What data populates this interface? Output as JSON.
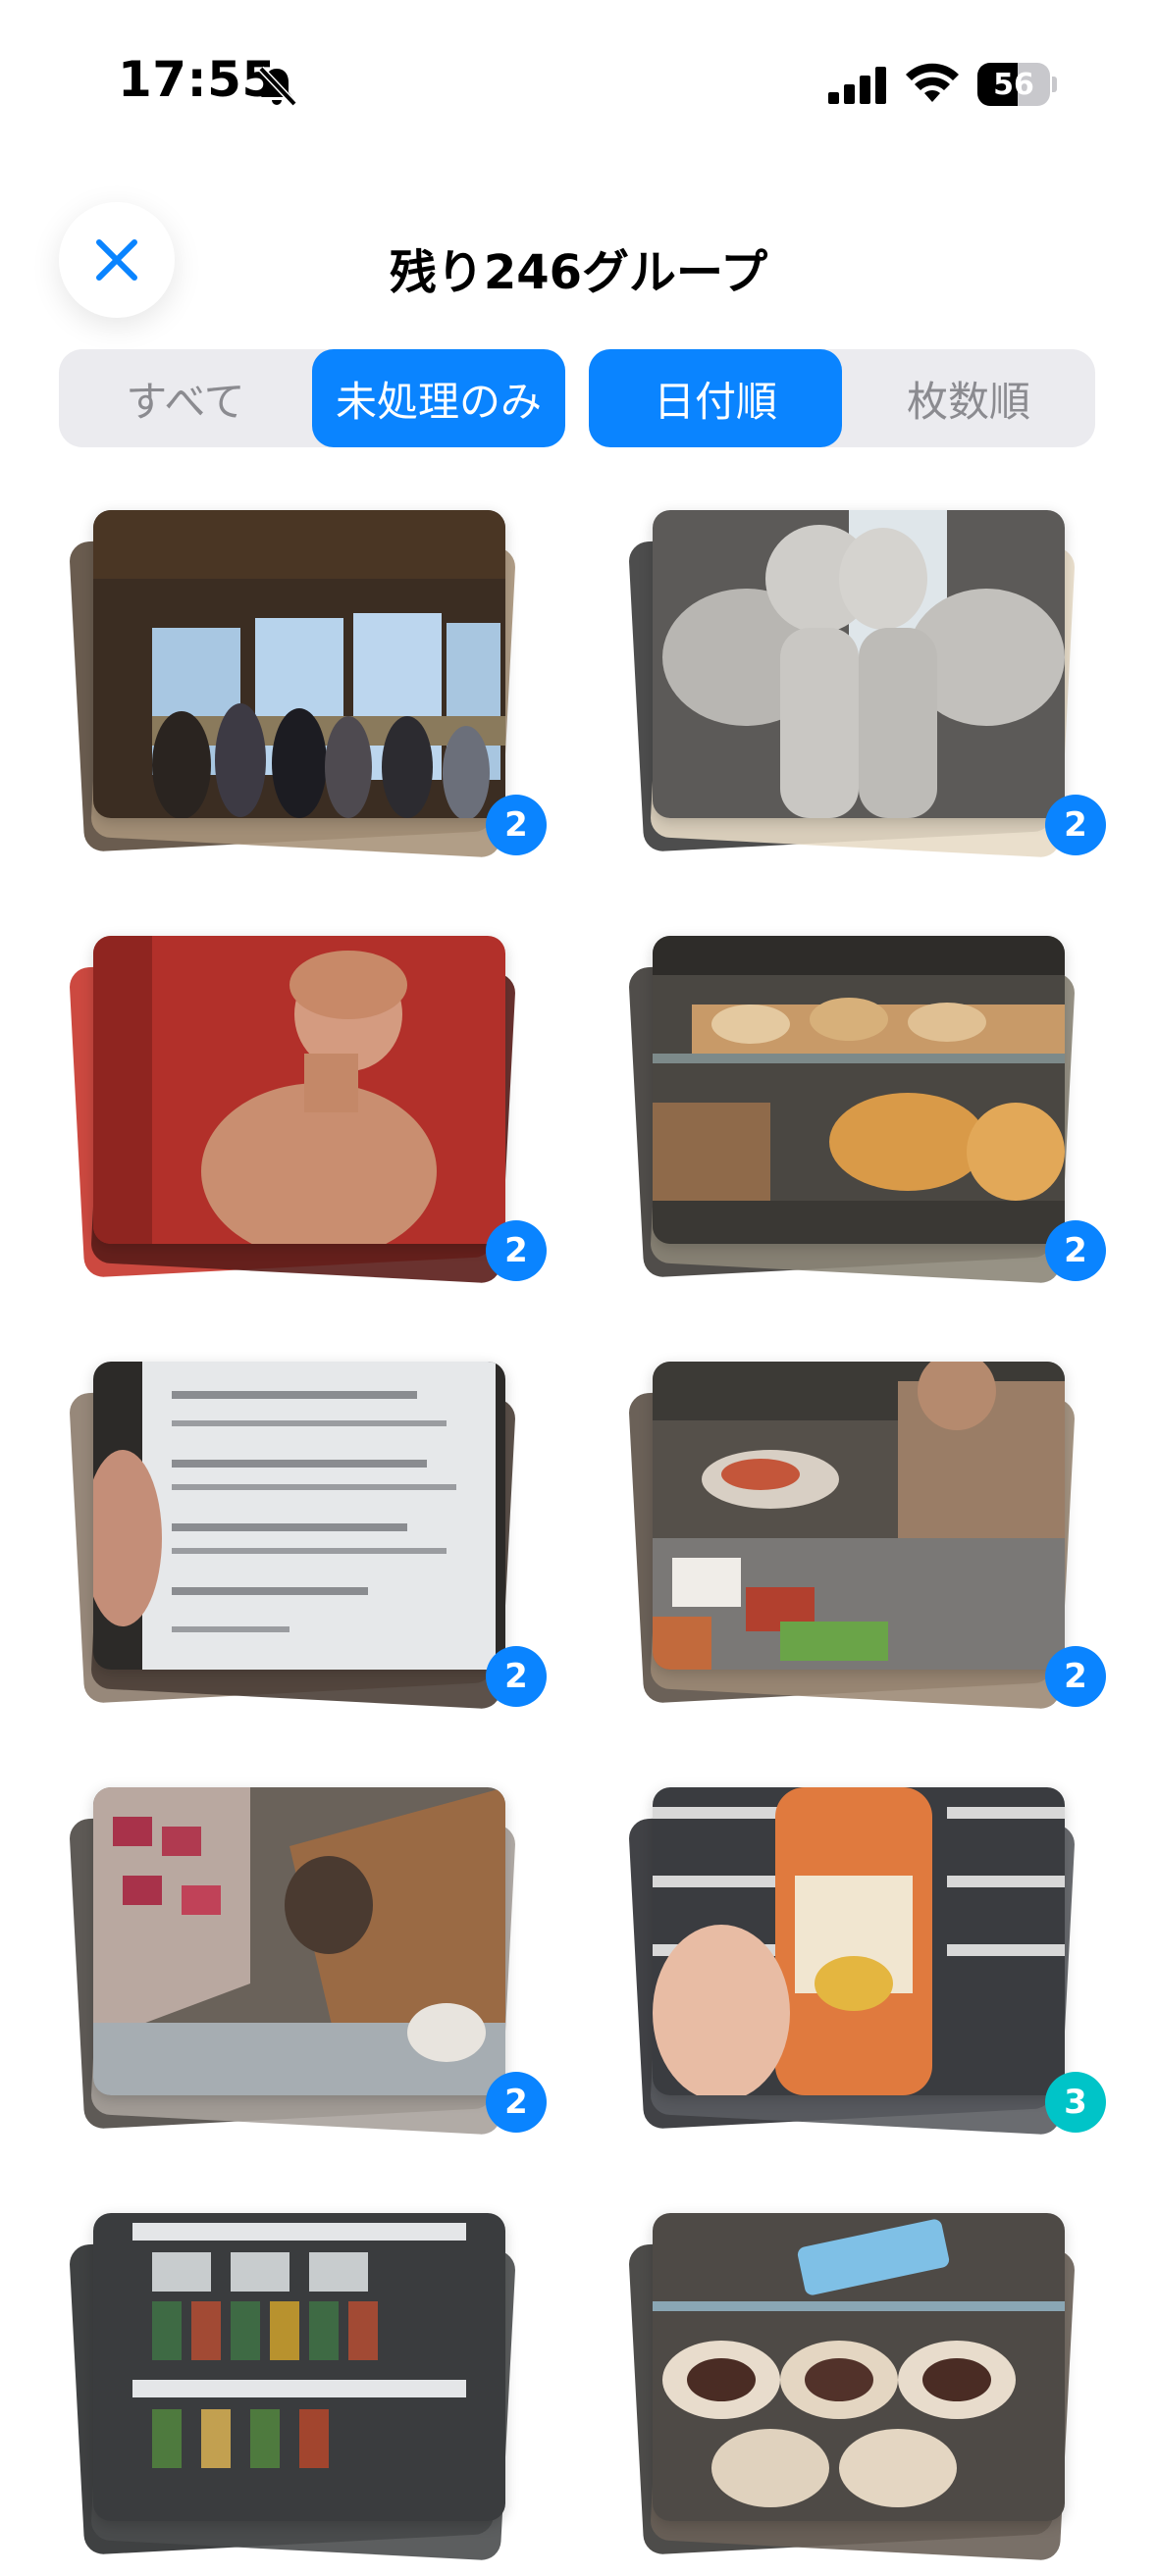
{
  "status": {
    "time": "17:55",
    "battery": "56",
    "battery_level": 0.56
  },
  "header": {
    "title": "残り246グループ"
  },
  "filters": {
    "all": "すべて",
    "unprocessed": "未処理のみ"
  },
  "sorts": {
    "date": "日付順",
    "count": "枚数順"
  },
  "colors": {
    "accent": "#0a84ff",
    "teal_badge": "#00c4c8"
  },
  "groups": [
    {
      "label": "窓辺の人々",
      "count": "2"
    },
    {
      "label": "天使像",
      "count": "2"
    },
    {
      "label": "赤壁の彫像",
      "count": "2"
    },
    {
      "label": "ショーケースの菓子",
      "count": "2"
    },
    {
      "label": "メニュー",
      "count": "2"
    },
    {
      "label": "カウンターの店員",
      "count": "2"
    },
    {
      "label": "店内の棚",
      "count": "2"
    },
    {
      "label": "ソースの瓶",
      "count": "3"
    },
    {
      "label": "冷蔵棚",
      "count": ""
    },
    {
      "label": "デリケース",
      "count": ""
    }
  ]
}
